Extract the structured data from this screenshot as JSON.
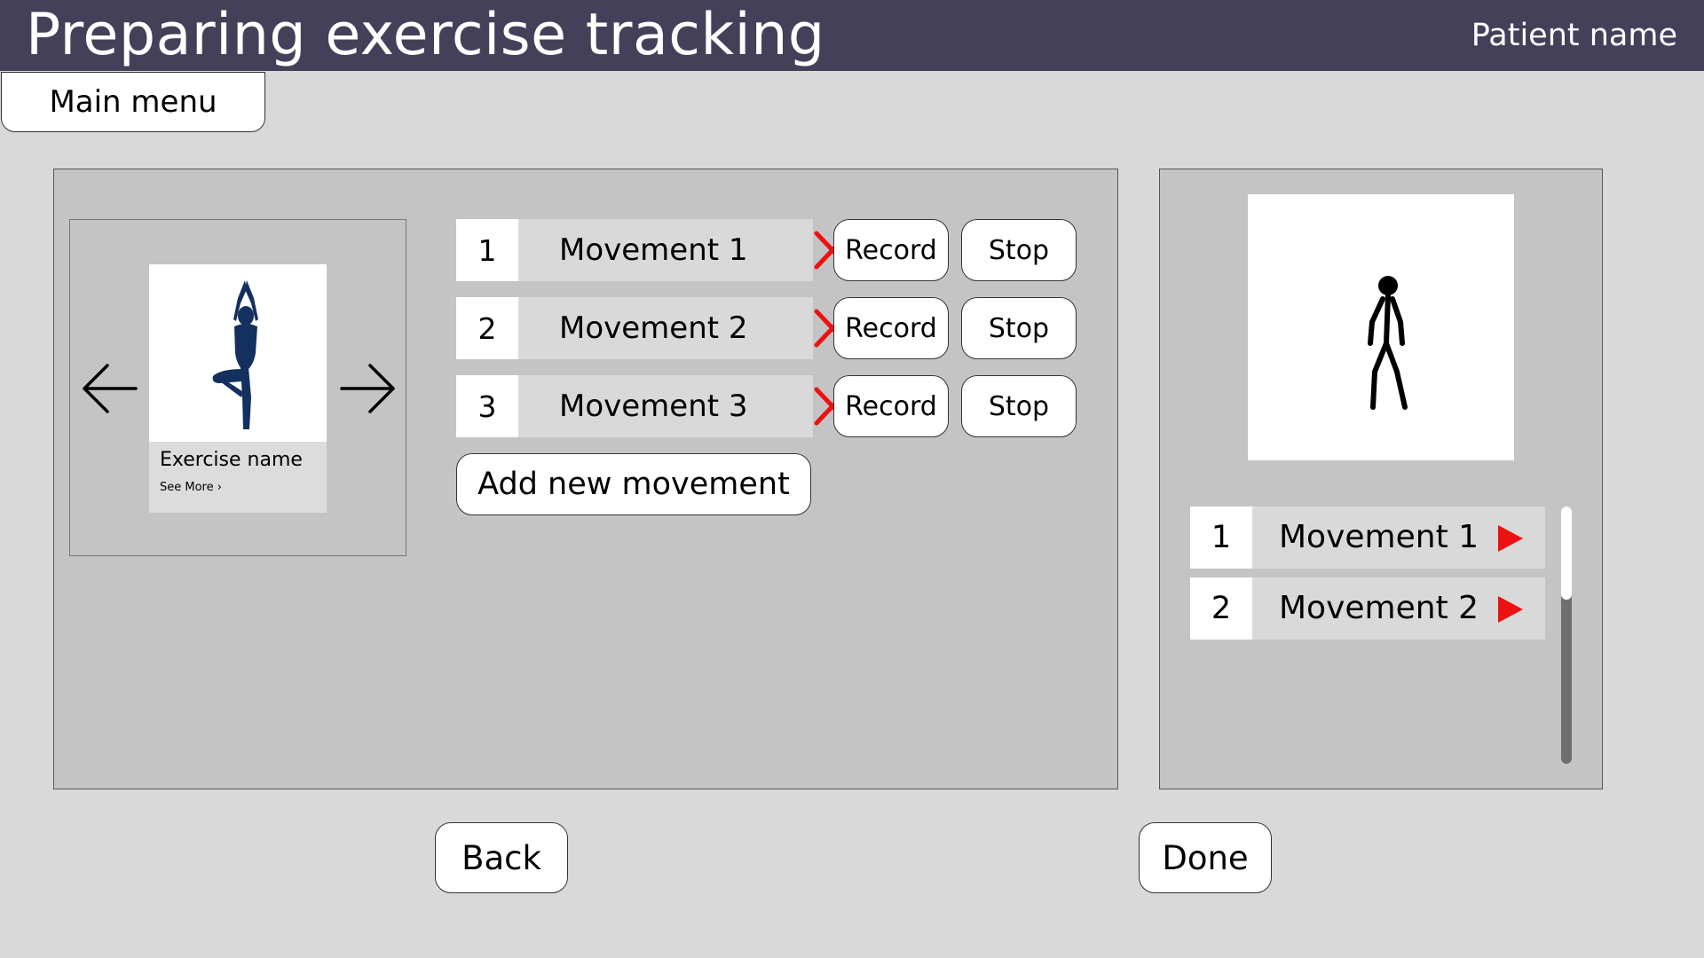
{
  "header": {
    "title": "Preparing exercise tracking",
    "patient": "Patient name",
    "bg_color": "#45405a"
  },
  "main_menu_label": "Main menu",
  "exercise_card": {
    "name": "Exercise name",
    "link": "See More ›",
    "figure_color": "#13305e"
  },
  "movements": [
    {
      "number": "1",
      "label": "Movement 1",
      "record": "Record",
      "stop": "Stop"
    },
    {
      "number": "2",
      "label": "Movement 2",
      "record": "Record",
      "stop": "Stop"
    },
    {
      "number": "3",
      "label": "Movement 3",
      "record": "Record",
      "stop": "Stop"
    }
  ],
  "add_movement_label": "Add new movement",
  "playlist": [
    {
      "number": "1",
      "label": "Movement 1"
    },
    {
      "number": "2",
      "label": "Movement 2"
    }
  ],
  "accent_color": "#ee1111",
  "back_label": "Back",
  "done_label": "Done"
}
